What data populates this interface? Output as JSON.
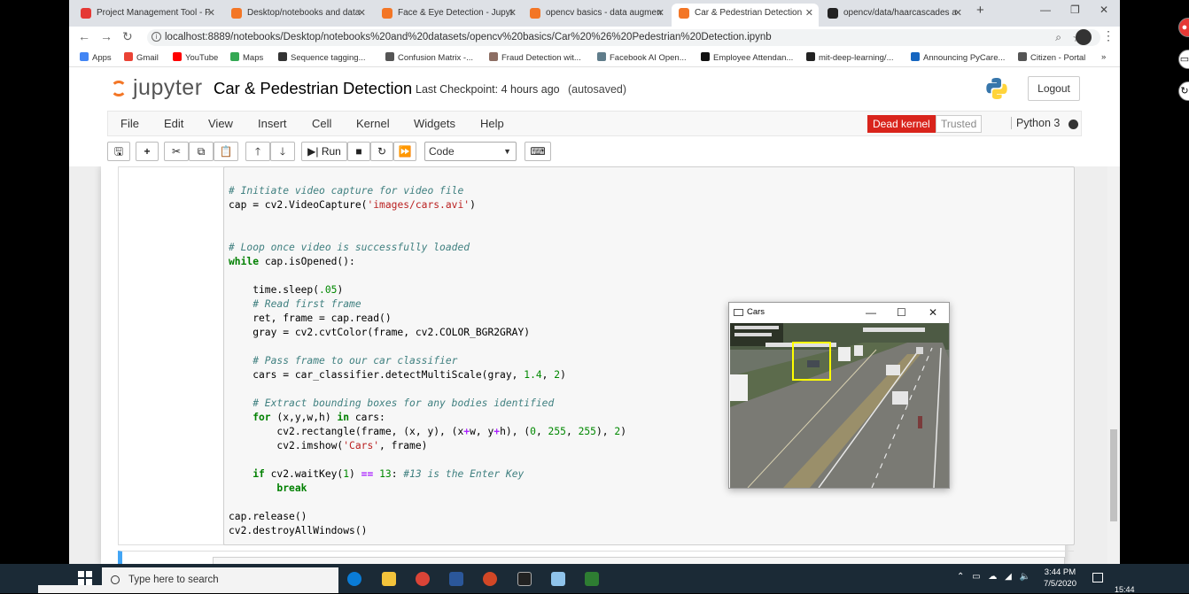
{
  "browser": {
    "tabs": [
      {
        "title": "Project Management Tool - F",
        "color": "#e53935"
      },
      {
        "title": "Desktop/notebooks and data",
        "color": "#f37626"
      },
      {
        "title": "Face & Eye Detection - Jupyt",
        "color": "#f37626"
      },
      {
        "title": "opencv basics - data augmen",
        "color": "#f37626"
      },
      {
        "title": "Car & Pedestrian Detection",
        "color": "#f37626"
      },
      {
        "title": "opencv/data/haarcascades a",
        "color": "#222222"
      }
    ],
    "new_tab": "+",
    "url": "localhost:8889/notebooks/Desktop/notebooks%20and%20datasets/opencv%20basics/Car%20%26%20Pedestrian%20Detection.ipynb",
    "bookmarks": [
      {
        "label": "Apps",
        "color": "#4285f4"
      },
      {
        "label": "Gmail",
        "color": "#ea4335"
      },
      {
        "label": "YouTube",
        "color": "#ff0000"
      },
      {
        "label": "Maps",
        "color": "#34a853"
      },
      {
        "label": "Sequence tagging...",
        "color": "#333333"
      },
      {
        "label": "Confusion Matrix -...",
        "color": "#555555"
      },
      {
        "label": "Fraud Detection wit...",
        "color": "#8d6e63"
      },
      {
        "label": "Facebook AI Open...",
        "color": "#607d8b"
      },
      {
        "label": "Employee Attendan...",
        "color": "#111111"
      },
      {
        "label": "mit-deep-learning/...",
        "color": "#222222"
      },
      {
        "label": "Announcing PyCare...",
        "color": "#1565c0"
      },
      {
        "label": "Citizen - Portal",
        "color": "#555555"
      }
    ],
    "bookmarks_more": "»"
  },
  "jupyter": {
    "logo_text": "jupyter",
    "notebook_name": "Car & Pedestrian Detection",
    "checkpoint": "Last Checkpoint: 4 hours ago",
    "autosaved": "(autosaved)",
    "logout": "Logout",
    "menus": [
      "File",
      "Edit",
      "View",
      "Insert",
      "Cell",
      "Kernel",
      "Widgets",
      "Help"
    ],
    "kernel_status": "Dead kernel",
    "trusted": "Trusted",
    "kernel_name": "Python 3",
    "toolbar": {
      "run": "Run",
      "cell_type": "Code"
    }
  },
  "code_lines": [
    {
      "t": "comment",
      "text": "# Initiate video capture for video file"
    },
    {
      "t": "mixed",
      "parts": [
        [
          "",
          "cap = cv2.VideoCapture("
        ],
        [
          "string",
          "'images/cars.avi'"
        ],
        [
          "",
          ")"
        ]
      ]
    },
    {
      "t": "blank"
    },
    {
      "t": "blank"
    },
    {
      "t": "comment",
      "text": "# Loop once video is successfully loaded"
    },
    {
      "t": "mixed",
      "parts": [
        [
          "keyword",
          "while"
        ],
        [
          "",
          " cap.isOpened():"
        ]
      ]
    },
    {
      "t": "blank"
    },
    {
      "t": "mixed",
      "parts": [
        [
          "",
          "    time.sleep("
        ],
        [
          "number",
          ".05"
        ],
        [
          "",
          ")"
        ]
      ]
    },
    {
      "t": "comment",
      "text": "    # Read first frame"
    },
    {
      "t": "mixed",
      "parts": [
        [
          "",
          "    ret, frame = cap.read()"
        ]
      ]
    },
    {
      "t": "mixed",
      "parts": [
        [
          "",
          "    gray = cv2.cvtColor(frame, cv2.COLOR_BGR2GRAY)"
        ]
      ]
    },
    {
      "t": "blank"
    },
    {
      "t": "comment",
      "text": "    # Pass frame to our car classifier"
    },
    {
      "t": "mixed",
      "parts": [
        [
          "",
          "    cars = car_classifier.detectMultiScale(gray, "
        ],
        [
          "number",
          "1.4"
        ],
        [
          "",
          ", "
        ],
        [
          "number",
          "2"
        ],
        [
          "",
          ")"
        ]
      ]
    },
    {
      "t": "blank"
    },
    {
      "t": "comment",
      "text": "    # Extract bounding boxes for any bodies identified"
    },
    {
      "t": "mixed",
      "parts": [
        [
          "keyword",
          "    for"
        ],
        [
          "",
          " (x,y,w,h) "
        ],
        [
          "keyword",
          "in"
        ],
        [
          "",
          " cars:"
        ]
      ]
    },
    {
      "t": "mixed",
      "parts": [
        [
          "",
          "        cv2.rectangle(frame, (x, y), (x"
        ],
        [
          "op",
          "+"
        ],
        [
          "",
          "w, y"
        ],
        [
          "op",
          "+"
        ],
        [
          "",
          "h), ("
        ],
        [
          "number",
          "0"
        ],
        [
          "",
          ", "
        ],
        [
          "number",
          "255"
        ],
        [
          "",
          ", "
        ],
        [
          "number",
          "255"
        ],
        [
          "",
          "), "
        ],
        [
          "number",
          "2"
        ],
        [
          "",
          ")"
        ]
      ]
    },
    {
      "t": "mixed",
      "parts": [
        [
          "",
          "        cv2.imshow("
        ],
        [
          "string",
          "'Cars'"
        ],
        [
          "",
          ", frame)"
        ]
      ]
    },
    {
      "t": "blank"
    },
    {
      "t": "mixed",
      "parts": [
        [
          "keyword",
          "    if"
        ],
        [
          "",
          " cv2.waitKey("
        ],
        [
          "number",
          "1"
        ],
        [
          "",
          ") "
        ],
        [
          "op",
          "=="
        ],
        [
          "",
          " "
        ],
        [
          "number",
          "13"
        ],
        [
          "",
          ": "
        ],
        [
          "comment",
          "#13 is the Enter Key"
        ]
      ]
    },
    {
      "t": "mixed",
      "parts": [
        [
          "keyword",
          "        break"
        ]
      ]
    },
    {
      "t": "blank"
    },
    {
      "t": "mixed",
      "parts": [
        [
          "",
          "cap.release()"
        ]
      ]
    },
    {
      "t": "mixed",
      "parts": [
        [
          "",
          "cv2.destroyAllWindows()"
        ]
      ]
    }
  ],
  "cv_window": {
    "title": "Cars"
  },
  "taskbar": {
    "search_placeholder": "Type here to search",
    "time": "3:44 PM",
    "date": "7/5/2020",
    "corner_time": "15:44",
    "tray": "⌃ ▭ ☁ ◢ 🔈"
  }
}
